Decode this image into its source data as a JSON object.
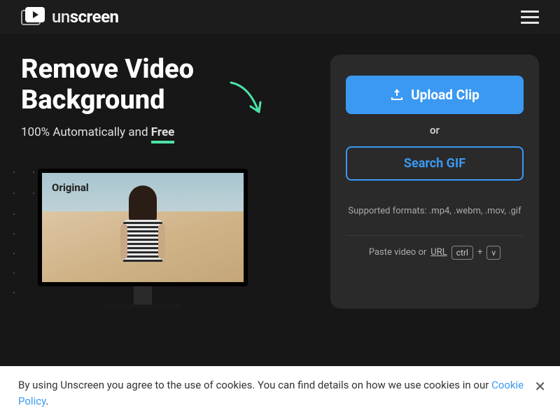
{
  "header": {
    "brand_prefix": "un",
    "brand_bold": "screen"
  },
  "hero": {
    "headline_l1": "Remove Video",
    "headline_l2": "Background",
    "subline_prefix": "100% Automatically and ",
    "subline_highlight": "Free",
    "preview_label": "Original"
  },
  "upload": {
    "button_label": "Upload Clip",
    "or": "or",
    "search_label": "Search GIF",
    "formats": "Supported formats: .mp4, .webm, .mov, .gif",
    "paste_prefix": "Paste video or ",
    "paste_url": "URL",
    "key_ctrl": "ctrl",
    "plus": "+",
    "key_v": "v"
  },
  "cookie": {
    "text": "By using Unscreen you agree to the use of cookies. You can find details on how we use cookies in our ",
    "link": "Cookie Policy",
    "dot": "."
  }
}
